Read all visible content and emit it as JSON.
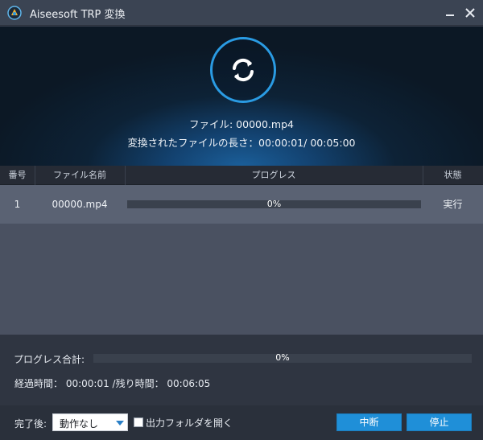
{
  "window": {
    "title": "Aiseesoft TRP 変換",
    "icons": [
      "app-logo-icon",
      "minimize-icon",
      "close-icon"
    ]
  },
  "hero": {
    "icon": "convert-refresh-icon",
    "file_text": "ファイル: 00000.mp4",
    "length_text": "変換されたファイルの長さ：00:00:01/ 00:05:00"
  },
  "table": {
    "columns": [
      "番号",
      "ファイル名前",
      "プログレス",
      "状態"
    ],
    "rows": [
      {
        "number": "1",
        "filename": "00000.mp4",
        "progress": 0,
        "progress_text": "0%",
        "status": "実行"
      }
    ]
  },
  "summary": {
    "total_label": "プログレス合計:",
    "total_progress": 0,
    "total_progress_text": "0%",
    "time_text": "経過時間： 00:00:01 /残り時間： 00:06:05"
  },
  "footer": {
    "after_label": "完了後:",
    "after_selected": "動作なし",
    "open_folder_label": "出力フォルダを開く",
    "open_folder_checked": false,
    "pause_label": "中断",
    "stop_label": "停止"
  },
  "colors": {
    "accent": "#2a9be3",
    "button": "#1f8fd8",
    "row_selected": "#5a6273"
  }
}
